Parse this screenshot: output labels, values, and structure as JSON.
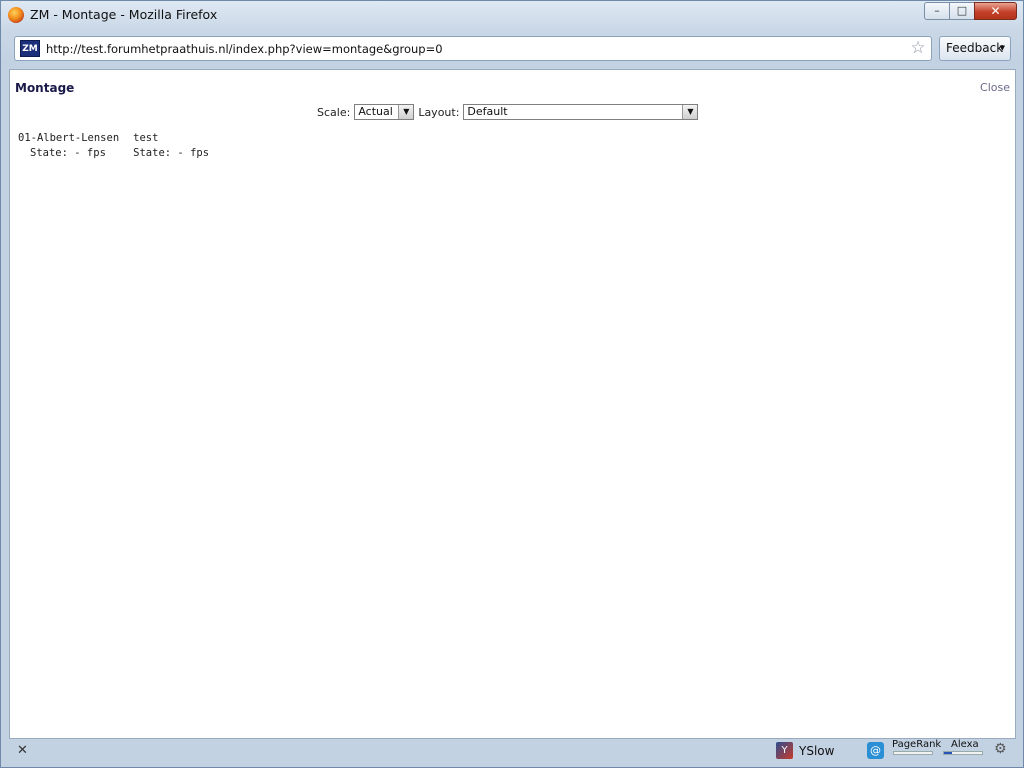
{
  "window": {
    "title": "ZM - Montage - Mozilla Firefox",
    "minimize_glyph": "–",
    "maximize_glyph": "□",
    "close_glyph": "✕"
  },
  "toolbar": {
    "site_icon_text": "ZM",
    "url": "http://test.forumhetpraathuis.nl/index.php?view=montage&group=0",
    "bookmark_icon": "star-icon",
    "feedback_label": "Feedback"
  },
  "page": {
    "title": "Montage",
    "close_label": "Close",
    "scale": {
      "label": "Scale:",
      "selected": "Actual"
    },
    "layout": {
      "label": "Layout:",
      "selected": "Default"
    },
    "monitors": [
      {
        "name": "01-Albert-Lensen",
        "state_label": "State:",
        "state_value": "-",
        "fps_label": "fps"
      },
      {
        "name": "test",
        "state_label": "State:",
        "state_value": "-",
        "fps_label": "fps"
      }
    ]
  },
  "statusbar": {
    "close_glyph": "✕",
    "yslow_label": "YSlow",
    "pagerank_label": "PageRank",
    "alexa_label": "Alexa",
    "alexa_level": 0.2
  }
}
